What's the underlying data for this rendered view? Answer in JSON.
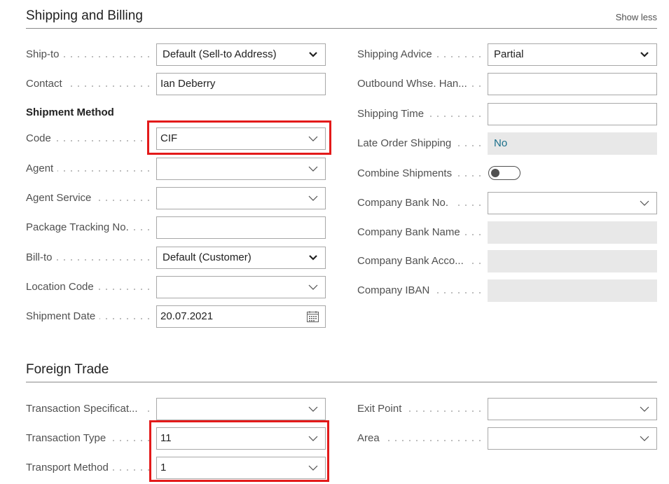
{
  "shipping_billing": {
    "title": "Shipping and Billing",
    "show_less": "Show less",
    "ship_to": {
      "label": "Ship-to",
      "value": "Default (Sell-to Address)"
    },
    "contact": {
      "label": "Contact",
      "value": "Ian Deberry"
    },
    "shipment_method_heading": "Shipment Method",
    "code": {
      "label": "Code",
      "value": "CIF"
    },
    "agent": {
      "label": "Agent",
      "value": ""
    },
    "agent_service": {
      "label": "Agent Service",
      "value": ""
    },
    "package_tracking": {
      "label": "Package Tracking No.",
      "value": ""
    },
    "bill_to": {
      "label": "Bill-to",
      "value": "Default (Customer)"
    },
    "location_code": {
      "label": "Location Code",
      "value": ""
    },
    "shipment_date": {
      "label": "Shipment Date",
      "value": "20.07.2021"
    },
    "shipping_advice": {
      "label": "Shipping Advice",
      "value": "Partial"
    },
    "outbound_whse": {
      "label": "Outbound Whse. Han...",
      "value": ""
    },
    "shipping_time": {
      "label": "Shipping Time",
      "value": ""
    },
    "late_order_shipping": {
      "label": "Late Order Shipping",
      "value": "No"
    },
    "combine_shipments": {
      "label": "Combine Shipments",
      "value": "off"
    },
    "company_bank_no": {
      "label": "Company Bank No.",
      "value": ""
    },
    "company_bank_name": {
      "label": "Company Bank Name",
      "value": ""
    },
    "company_bank_acco": {
      "label": "Company Bank Acco...",
      "value": ""
    },
    "company_iban": {
      "label": "Company IBAN",
      "value": ""
    }
  },
  "foreign_trade": {
    "title": "Foreign Trade",
    "transaction_spec": {
      "label": "Transaction Specificat...",
      "value": ""
    },
    "transaction_type": {
      "label": "Transaction Type",
      "value": "11"
    },
    "transport_method": {
      "label": "Transport Method",
      "value": "1"
    },
    "exit_point": {
      "label": "Exit Point",
      "value": ""
    },
    "area": {
      "label": "Area",
      "value": ""
    }
  },
  "colors": {
    "highlight": "#e31a1a",
    "readonly_bg": "#e8e8e8",
    "link_value": "#1a6f8a"
  },
  "icons": [
    "chevron-down-icon",
    "calendar-icon"
  ]
}
